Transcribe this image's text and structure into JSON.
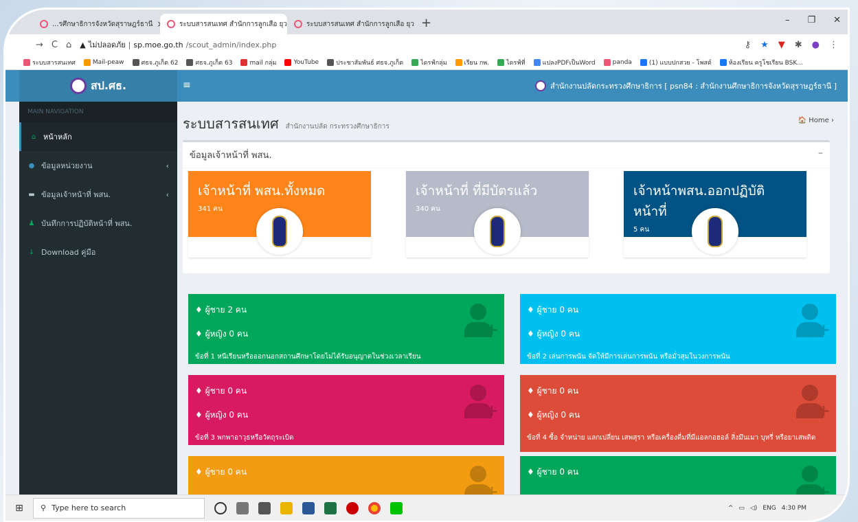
{
  "browser": {
    "tabs": [
      {
        "title": "...รศึกษาธิการจังหวัดสุราษฎร์ธานี",
        "close": "×"
      },
      {
        "title": "ระบบสารสนเทศ สำนักการลูกเสือ ยุวกา",
        "close": "×"
      },
      {
        "title": "ระบบสารสนเทศ สำนักการลูกเสือ ยุวกา",
        "close": "×"
      }
    ],
    "new_tab": "+",
    "insecure_label": "ไม่ปลอดภัย",
    "url_host": "sp.moe.go.th",
    "url_path": "/scout_admin/index.php",
    "bookmarks": [
      "ระบบสารสนเทศ",
      "Mail-peaw",
      "ศธจ.ภูเก็ต 62",
      "ศธจ.ภูเก็ต 63",
      "mail กลุ่ม",
      "YouTube",
      "ประชาสัมพันธ์ ศธจ.ภูเก็ต",
      "ไดรฟ์กลุ่ม",
      "เรียน กพ.",
      "ไดรฟ์ที่",
      "แปลงPDFเป็นWord",
      "panda",
      "(1) แบบปกสวย - โพสต์",
      "ห้องเรียน ครูโชเรียน BSK..."
    ]
  },
  "header": {
    "logo_text": "สป.ศธ.",
    "user_text": "สำนักงานปลัดกระทรวงศึกษาธิการ [ psn84 : สำนักงานศึกษาธิการจังหวัดสุราษฎร์ธานี ]"
  },
  "sidebar": {
    "heading": "MAIN NAVIGATION",
    "items": [
      {
        "label": "หน้าหลัก"
      },
      {
        "label": "ข้อมูลหน่วยงาน"
      },
      {
        "label": "ข้อมูลเจ้าหน้าที่ พสน."
      },
      {
        "label": "บันทึกการปฏิบัติหน้าที่ พสน."
      },
      {
        "label": "Download คู่มือ"
      }
    ]
  },
  "page": {
    "title": "ระบบสารสนเทศ",
    "subtitle": "สำนักงานปลัด กระทรวงศึกษาธิการ",
    "breadcrumb": "Home",
    "box_title": "ข้อมูลเจ้าหน้าที่ พสน."
  },
  "cards": [
    {
      "title": "เจ้าหน้าที่ พสน.ทั้งหมด",
      "count": "341 คน",
      "color": "#ff851b"
    },
    {
      "title": "เจ้าหน้าที่ ที่มีบัตรแล้ว",
      "count": "340 คน",
      "color": "#b5bbc8"
    },
    {
      "title": "เจ้าหน้าพสน.ออกปฏิบัติหน้าที่",
      "count": "5 คน",
      "color": "#005384"
    }
  ],
  "stats": [
    {
      "male": "ผู้ชาย 2 คน",
      "female": "ผู้หญิง 0 คน",
      "desc": "ข้อที่ 1 หนีเรียนหรือออกนอกสถานศึกษาโดยไม่ได้รับอนุญาตในช่วงเวลาเรียน",
      "color": "#00a65a"
    },
    {
      "male": "ผู้ชาย 0 คน",
      "female": "ผู้หญิง 0 คน",
      "desc": "ข้อที่ 2 เล่นการพนัน จัดให้มีการเล่นการพนัน หรือมั่วสุมในวงการพนัน",
      "color": "#00c0ef"
    },
    {
      "male": "ผู้ชาย 0 คน",
      "female": "ผู้หญิง 0 คน",
      "desc": "ข้อที่ 3 พกพาอาวุธหรือวัตถุระเบิด",
      "color": "#d81b60"
    },
    {
      "male": "ผู้ชาย 0 คน",
      "female": "ผู้หญิง 0 คน",
      "desc": "ข้อที่ 4 ซื้อ จำหน่าย แลกเปลี่ยน เสพสุรา หรือเครื่องดื่มที่มีแอลกอฮอล์ สิ่งมึนเมา บุหรี่ หรือยาเสพติด",
      "color": "#dd4b39"
    },
    {
      "male": "ผู้ชาย 0 คน",
      "color": "#f39c12"
    },
    {
      "male": "ผู้ชาย 0 คน",
      "color": "#00a65a"
    }
  ],
  "taskbar": {
    "search_placeholder": "Type here to search",
    "lang": "ENG",
    "time": "4:30 PM"
  }
}
